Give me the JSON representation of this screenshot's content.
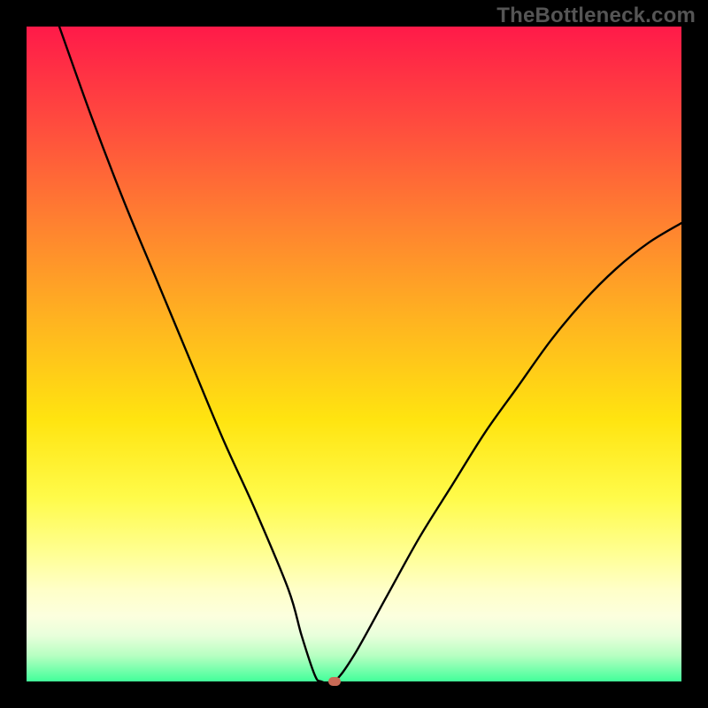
{
  "watermark": "TheBottleneck.com",
  "chart_data": {
    "type": "line",
    "title": "",
    "xlabel": "",
    "ylabel": "",
    "xlim": [
      0,
      100
    ],
    "ylim": [
      0,
      100
    ],
    "gradient_colors": {
      "top": "#ff1a49",
      "upper_mid": "#ff8130",
      "mid": "#ffe410",
      "lower": "#ffff8f",
      "bottom": "#42ff9a"
    },
    "series": [
      {
        "name": "bottleneck-curve",
        "x": [
          5,
          10,
          15,
          20,
          25,
          30,
          35,
          40,
          42,
          44,
          45,
          47,
          50,
          55,
          60,
          65,
          70,
          75,
          80,
          85,
          90,
          95,
          100
        ],
        "y": [
          100,
          86,
          73,
          61,
          49,
          37,
          26,
          14,
          7,
          1,
          0,
          0,
          4,
          13,
          22,
          30,
          38,
          45,
          52,
          58,
          63,
          67,
          70
        ]
      }
    ],
    "annotations": [
      {
        "name": "optimal-point",
        "x": 47,
        "y": 0,
        "color": "#c96a56"
      }
    ]
  }
}
